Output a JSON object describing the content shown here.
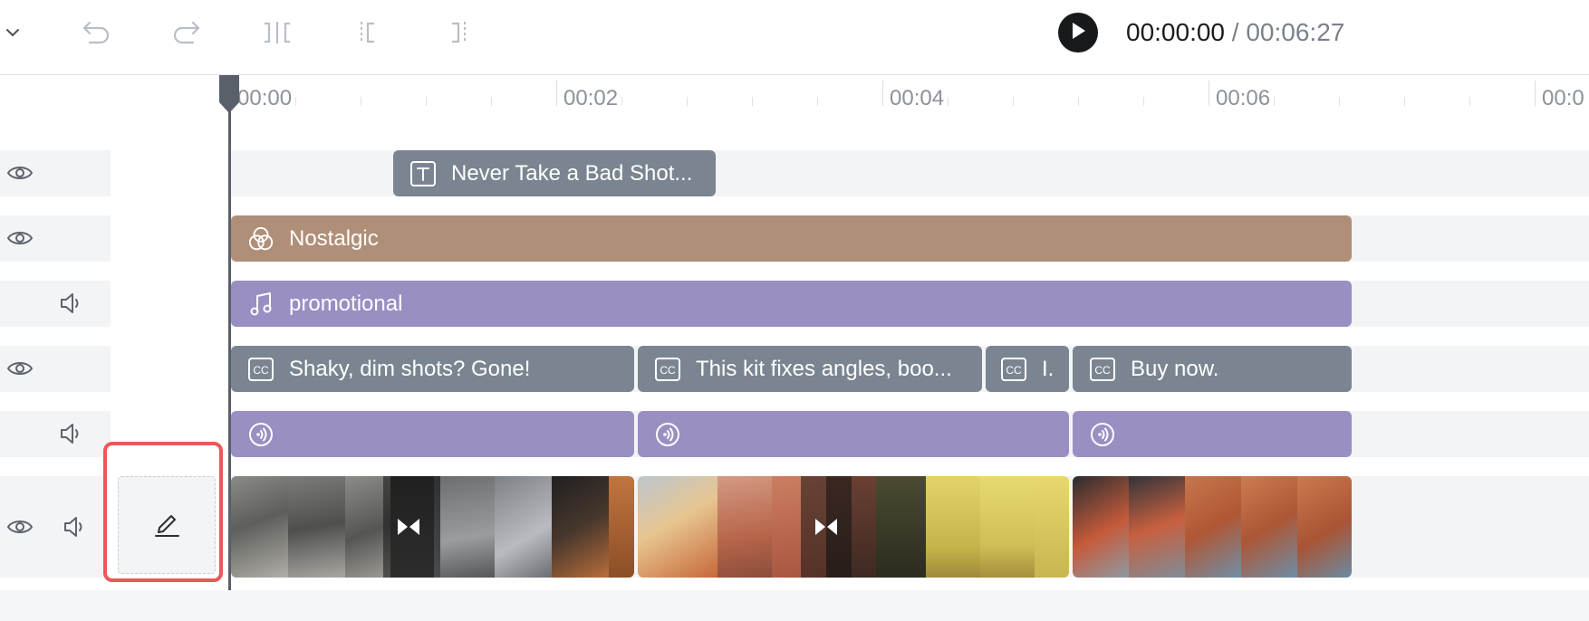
{
  "toolbar": {
    "time_current": "00:00:00",
    "time_separator": "/",
    "time_duration": "00:06:27",
    "icons": [
      "chevron-down-icon",
      "undo-icon",
      "redo-icon",
      "split-icon",
      "trim-left-icon",
      "trim-right-icon",
      "play-icon"
    ]
  },
  "ruler": {
    "labels": [
      "00:00",
      "00:02",
      "00:04",
      "00:06",
      "00:0"
    ]
  },
  "tracks": {
    "text": {
      "label": "Never Take a Bad Shot...",
      "icon": "text-icon"
    },
    "filter": {
      "label": "Nostalgic",
      "icon": "filter-icon"
    },
    "music": {
      "label": "promotional",
      "icon": "music-note-icon"
    },
    "captions": [
      {
        "label": "Shaky, dim shots? Gone!"
      },
      {
        "label": "This kit fixes angles, boo..."
      },
      {
        "label": "I."
      },
      {
        "label": "Buy now."
      }
    ],
    "voiceover": {
      "icon": "voiceover-icon"
    }
  },
  "colors": {
    "text_clip": "#7a8591",
    "filter_clip": "#b08f78",
    "audio_clip": "#9b8ec2",
    "caption_clip": "#7a8591",
    "highlight": "#e8595a"
  }
}
